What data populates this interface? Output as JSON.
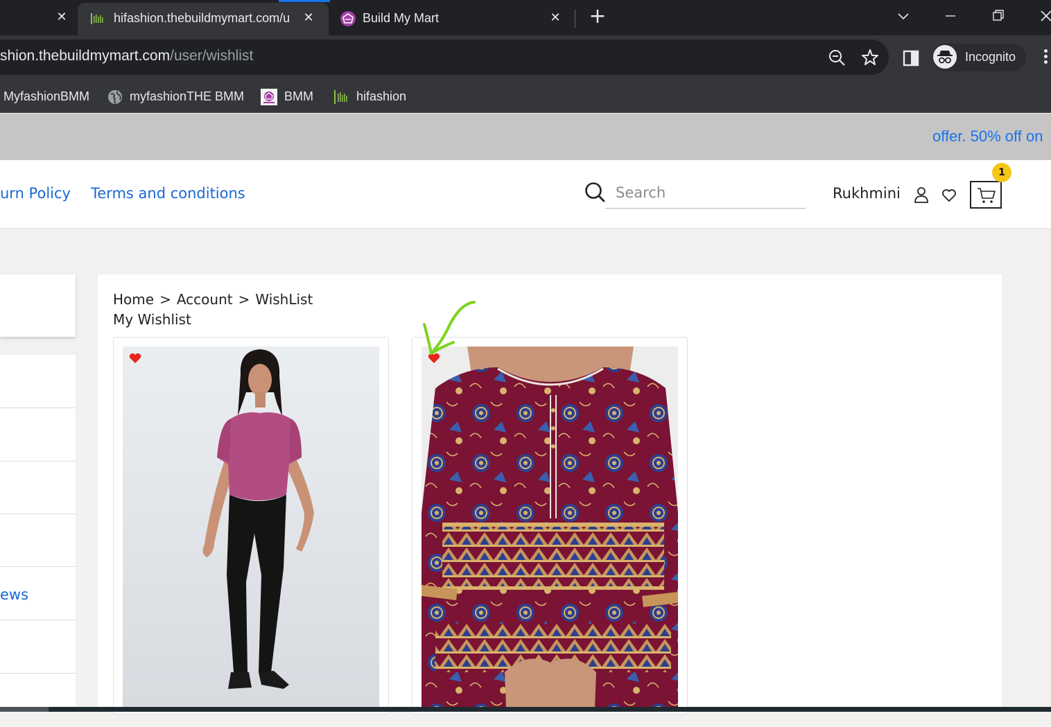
{
  "browser": {
    "tabs": [
      {
        "title": "hifashion.thebuildmymart.com/u",
        "active": true
      },
      {
        "title": "Build My Mart",
        "active": false
      }
    ],
    "url_host": "shion.thebuildmymart.com",
    "url_path": "/user/wishlist",
    "profile_label": "Incognito",
    "bookmarks": [
      "MyfashionBMM",
      "myfashionTHE BMM",
      "BMM",
      "hifashion"
    ],
    "close_glyph": "✕",
    "newtab_glyph": "+"
  },
  "promo": {
    "text": "offer. 50% off on"
  },
  "header": {
    "nav": [
      "urn Policy",
      "Terms and conditions"
    ],
    "search_placeholder": "Search",
    "user_name": "Rukhmini",
    "cart_count": "1"
  },
  "sidebar": {
    "items": [
      "",
      "",
      "",
      "",
      "ews",
      "",
      ""
    ]
  },
  "main": {
    "breadcrumb": [
      "Home",
      "Account",
      "WishList"
    ],
    "breadcrumb_sep": ">",
    "title": "My Wishlist",
    "products": [
      {
        "name": "pink-top-black-trousers",
        "wishlisted": true
      },
      {
        "name": "maroon-printed-kurta",
        "wishlisted": true
      }
    ]
  },
  "colors": {
    "link": "#1a67d2",
    "heart": "#e8231a",
    "badge": "#f5c518",
    "annotation": "#7ed321"
  }
}
